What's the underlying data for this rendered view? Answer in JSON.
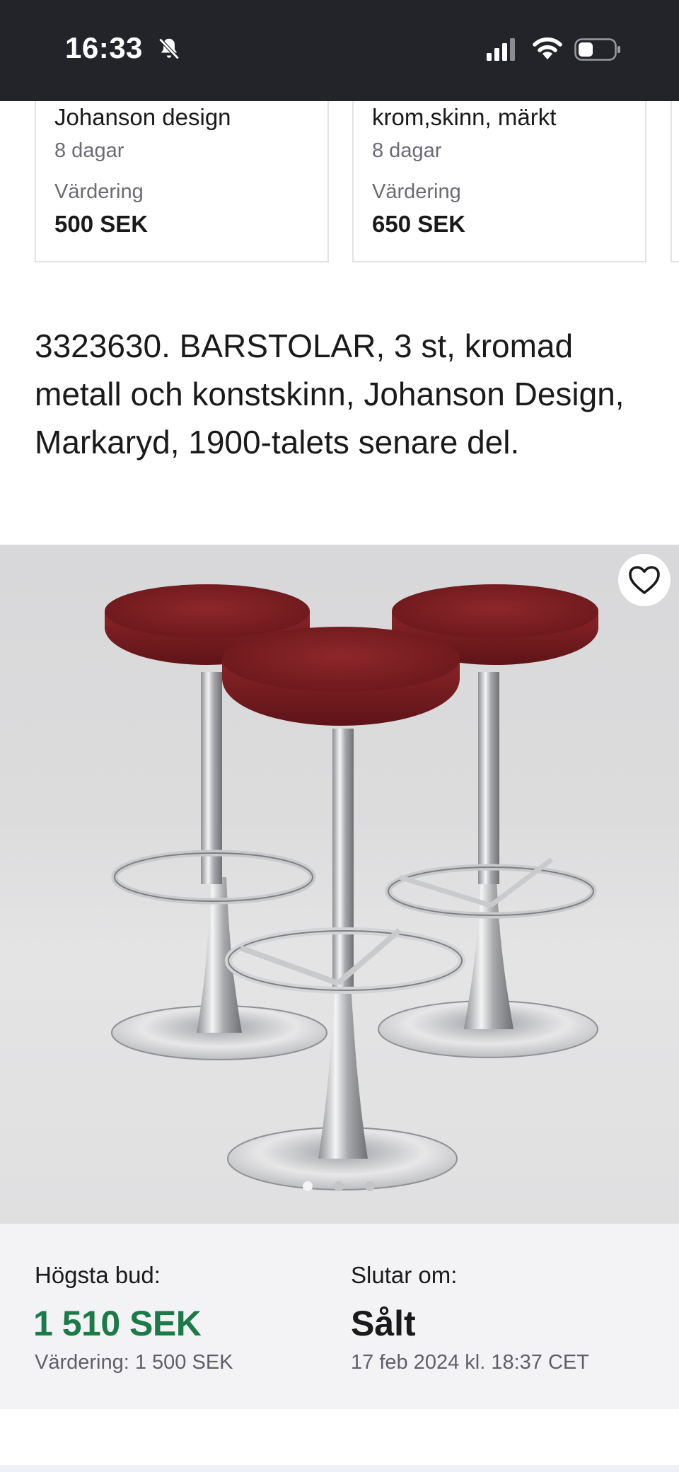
{
  "status_bar": {
    "time": "16:33",
    "icons": [
      "bell-slash-icon",
      "cellular-signal-icon",
      "wifi-icon",
      "battery-icon"
    ]
  },
  "related_cards": [
    {
      "title": "Johanson design",
      "days": "8 dagar",
      "valuation_label": "Värdering",
      "valuation": "500 SEK"
    },
    {
      "title": "krom,skinn, märkt",
      "days": "8 dagar",
      "valuation_label": "Värdering",
      "valuation": "650 SEK"
    }
  ],
  "lot": {
    "title": "3323630. BARSTOLAR, 3 st, kromad metall och konstskinn, Johanson Design, Markaryd, 1900-talets senare del."
  },
  "gallery": {
    "favorite_icon": "heart-outline-icon",
    "image_count": 3,
    "active_index": 1
  },
  "bidding": {
    "highest_bid_label": "Högsta bud:",
    "highest_bid": "1 510 SEK",
    "estimate": "Värdering: 1 500 SEK",
    "ends_label": "Slutar om:",
    "status": "Sålt",
    "end_date": "17 feb 2024 kl. 18:37 CET"
  },
  "colors": {
    "status_bar_bg": "#222429",
    "bid_amount": "#1c7a48",
    "panel_bg": "#f3f3f5",
    "seat_leather": "#7a1e22"
  }
}
